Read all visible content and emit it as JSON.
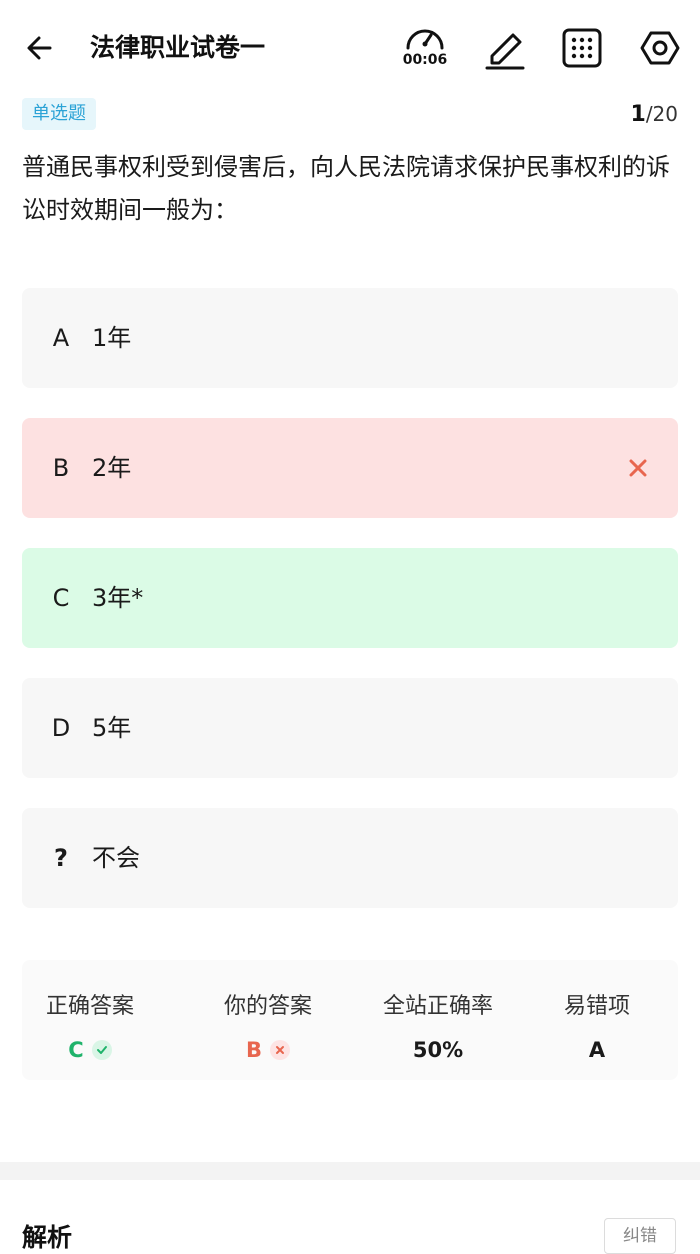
{
  "header": {
    "title": "法律职业试卷一",
    "timer": "00:06"
  },
  "question": {
    "type_label": "单选题",
    "current": "1",
    "total": "/20",
    "text": "普通民事权利受到侵害后，向人民法院请求保护民事权利的诉讼时效期间一般为："
  },
  "options": [
    {
      "letter": "A",
      "text": "1年",
      "state": "normal"
    },
    {
      "letter": "B",
      "text": "2年",
      "state": "wrong"
    },
    {
      "letter": "C",
      "text": "3年*",
      "state": "correct"
    },
    {
      "letter": "D",
      "text": "5年",
      "state": "normal"
    },
    {
      "letter": "?",
      "text": "不会",
      "state": "normal"
    }
  ],
  "stats": {
    "correct_answer_label": "正确答案",
    "correct_answer_value": "C",
    "your_answer_label": "你的答案",
    "your_answer_value": "B",
    "site_rate_label": "全站正确率",
    "site_rate_value": "50%",
    "error_prone_label": "易错项",
    "error_prone_value": "A"
  },
  "analysis": {
    "title": "解析",
    "report_label": "纠错"
  },
  "colors": {
    "accent_blue": "#2ba3d6",
    "correct_green": "#1fb36b",
    "wrong_red": "#e8664f",
    "wrong_bg": "#fde1e1",
    "correct_bg": "#dbfbe6"
  }
}
